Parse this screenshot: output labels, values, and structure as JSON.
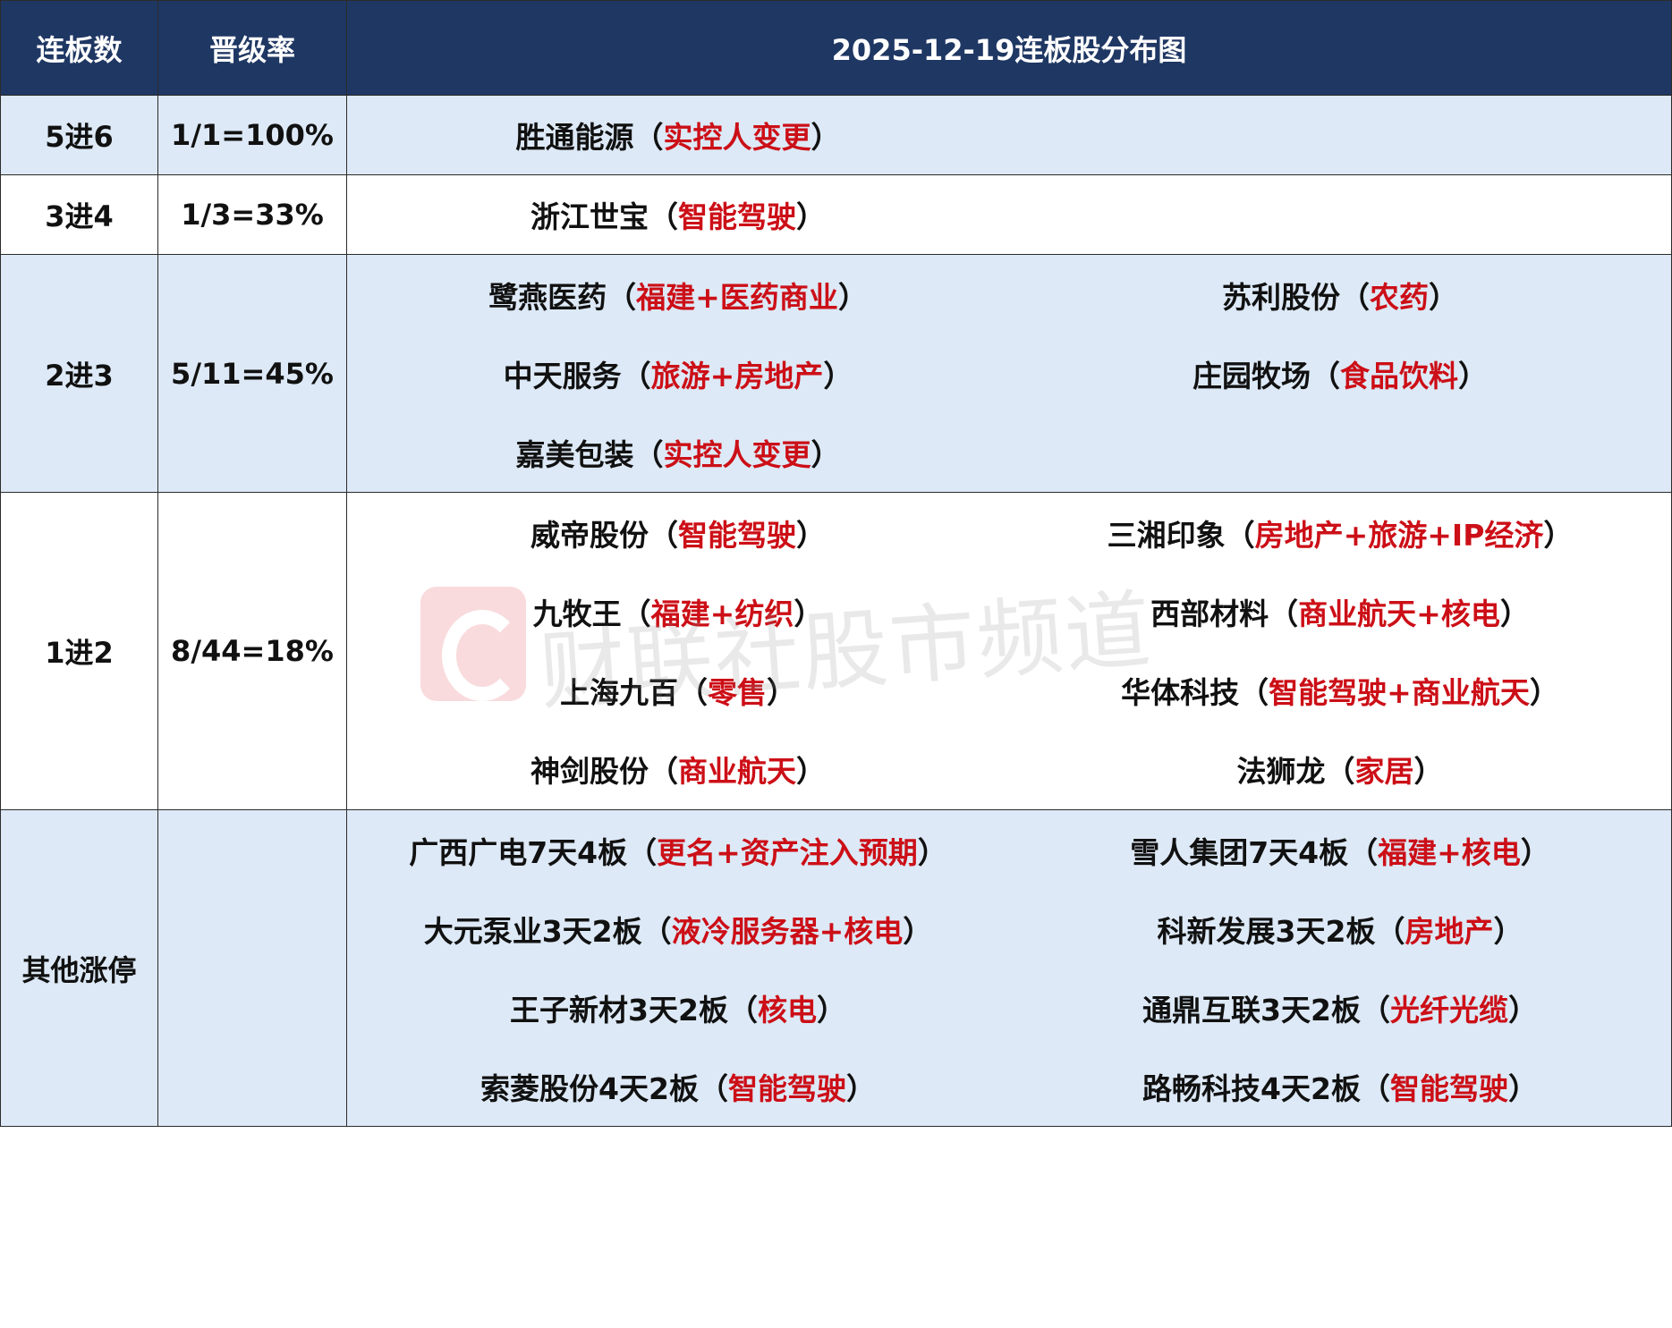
{
  "header": {
    "col1": "连板数",
    "col2": "晋级率",
    "col3": "2025-12-19连板股分布图"
  },
  "rows": [
    {
      "label": "5进6",
      "rate": "1/1=100%",
      "left": [
        {
          "name": "胜通能源",
          "tag": "实控人变更"
        }
      ],
      "right": []
    },
    {
      "label": "3进4",
      "rate": "1/3=33%",
      "left": [
        {
          "name": "浙江世宝",
          "tag": "智能驾驶"
        }
      ],
      "right": []
    },
    {
      "label": "2进3",
      "rate": "5/11=45%",
      "left": [
        {
          "name": "鹭燕医药",
          "tag": "福建+医药商业"
        },
        {
          "name": "中天服务",
          "tag": "旅游+房地产"
        },
        {
          "name": "嘉美包装",
          "tag": "实控人变更"
        }
      ],
      "right": [
        {
          "name": "苏利股份",
          "tag": "农药"
        },
        {
          "name": "庄园牧场",
          "tag": "食品饮料"
        }
      ]
    },
    {
      "label": "1进2",
      "rate": "8/44=18%",
      "left": [
        {
          "name": "威帝股份",
          "tag": "智能驾驶"
        },
        {
          "name": "九牧王",
          "tag": "福建+纺织"
        },
        {
          "name": "上海九百",
          "tag": "零售"
        },
        {
          "name": "神剑股份",
          "tag": "商业航天"
        }
      ],
      "right": [
        {
          "name": "三湘印象",
          "tag": "房地产+旅游+IP经济"
        },
        {
          "name": "西部材料",
          "tag": "商业航天+核电"
        },
        {
          "name": "华体科技",
          "tag": "智能驾驶+商业航天"
        },
        {
          "name": "法狮龙",
          "tag": "家居"
        }
      ]
    },
    {
      "label": "其他涨停",
      "rate": "",
      "left": [
        {
          "name": "广西广电7天4板",
          "tag": "更名+资产注入预期"
        },
        {
          "name": "大元泵业3天2板",
          "tag": "液冷服务器+核电"
        },
        {
          "name": "王子新材3天2板",
          "tag": "核电"
        },
        {
          "name": "索菱股份4天2板",
          "tag": "智能驾驶"
        }
      ],
      "right": [
        {
          "name": "雪人集团7天4板",
          "tag": "福建+核电"
        },
        {
          "name": "科新发展3天2板",
          "tag": "房地产"
        },
        {
          "name": "通鼎互联3天2板",
          "tag": "光纤光缆"
        },
        {
          "name": "路畅科技4天2板",
          "tag": "智能驾驶"
        }
      ]
    }
  ],
  "watermark": {
    "text": "财联社股市频道",
    "logo_icon": "cls-c-logo-icon"
  },
  "colors": {
    "header_bg": "#1f3763",
    "header_text": "#ffffff",
    "row_shade": "#dde9f6",
    "tag_red": "#cc0f17",
    "text": "#111111"
  }
}
